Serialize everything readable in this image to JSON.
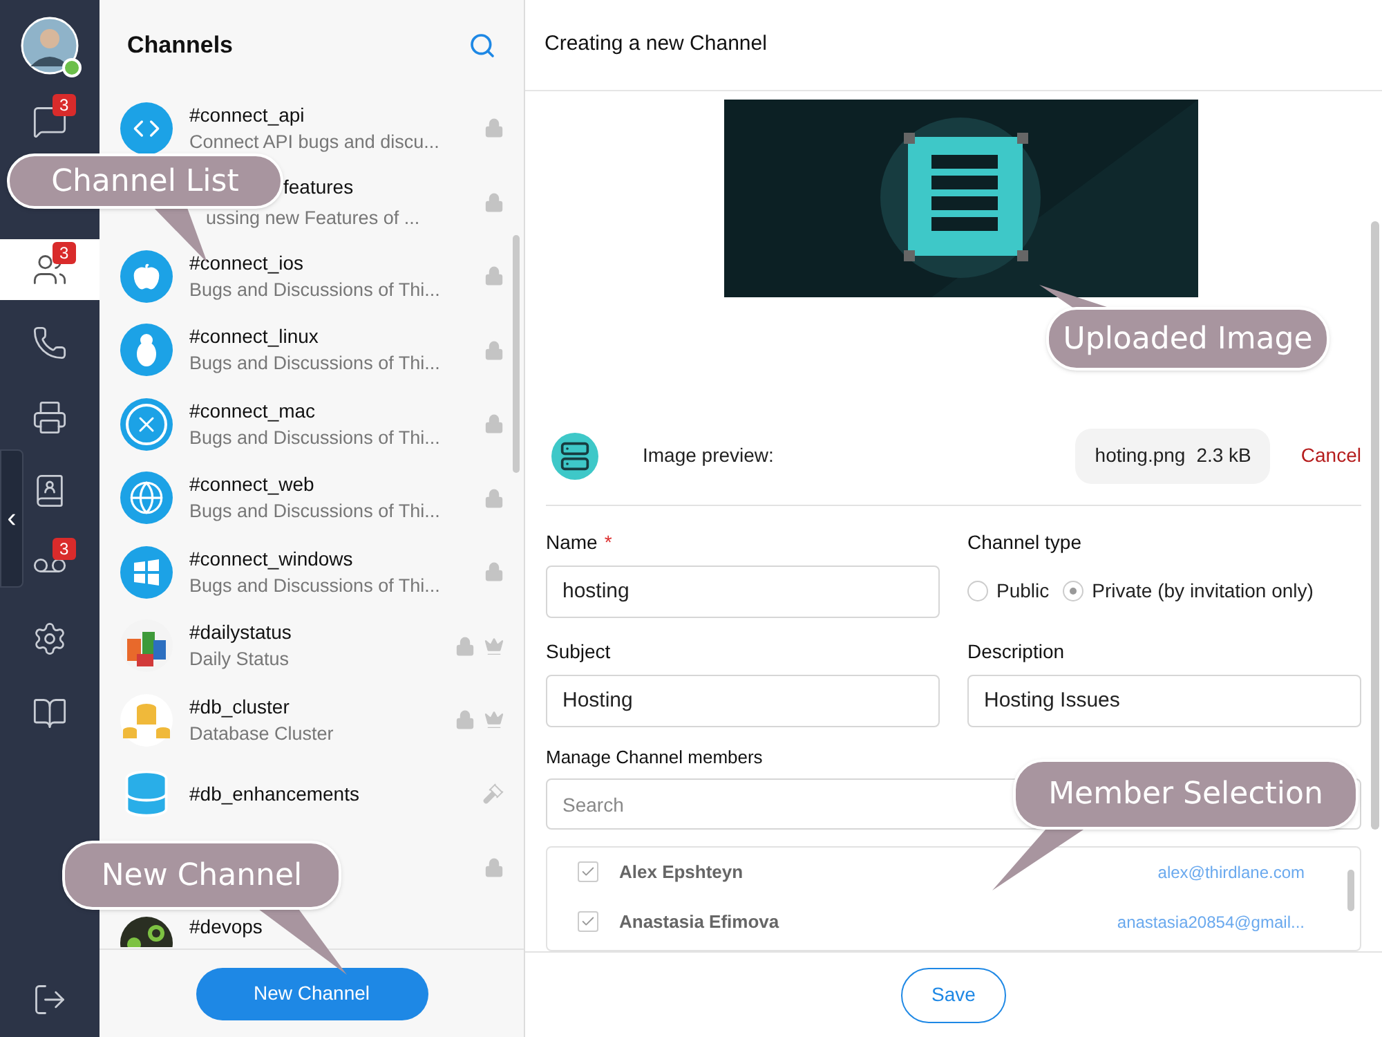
{
  "nav": {
    "user": {
      "online": true
    },
    "items": [
      {
        "kind": "chat",
        "badge": "3",
        "selected": false
      },
      {
        "kind": "contacts",
        "badge": "3",
        "selected": true
      },
      {
        "kind": "phone",
        "selected": false
      },
      {
        "kind": "printer",
        "selected": false
      },
      {
        "kind": "addressbook",
        "selected": false
      },
      {
        "kind": "voicemail",
        "badge": "3",
        "selected": false
      },
      {
        "kind": "settings",
        "selected": false
      },
      {
        "kind": "book",
        "selected": false
      }
    ],
    "collapse": "‹"
  },
  "channels": {
    "title": "Channels",
    "items": [
      {
        "name": "#connect_api",
        "description": "Connect API bugs and discu...",
        "kind": "api",
        "locked": true,
        "owner": false,
        "moderated": false
      },
      {
        "name": "features",
        "description": "ussing new Features of ...",
        "locked": true,
        "owner": false,
        "moderated": false
      },
      {
        "name": "#connect_ios",
        "description": "Bugs and Discussions of Thi...",
        "kind": "apple",
        "locked": true,
        "owner": false,
        "moderated": false
      },
      {
        "name": "#connect_linux",
        "description": "Bugs and Discussions of Thi...",
        "kind": "linux",
        "locked": true,
        "owner": false,
        "moderated": false
      },
      {
        "name": "#connect_mac",
        "description": "Bugs and Discussions of Thi...",
        "kind": "mac",
        "locked": true,
        "owner": false,
        "moderated": false
      },
      {
        "name": "#connect_web",
        "description": "Bugs and Discussions of Thi...",
        "kind": "web",
        "locked": true,
        "owner": false,
        "moderated": false
      },
      {
        "name": "#connect_windows",
        "description": "Bugs and Discussions of Thi...",
        "kind": "windows",
        "locked": true,
        "owner": false,
        "moderated": false
      },
      {
        "name": "#dailystatus",
        "description": "Daily Status",
        "kind": "picture",
        "locked": true,
        "owner": true,
        "moderated": false
      },
      {
        "name": "#db_cluster",
        "description": "Database Cluster",
        "kind": "cluster",
        "locked": true,
        "owner": true,
        "moderated": false
      },
      {
        "name": "#db_enhancements",
        "kind": "database",
        "locked": false,
        "owner": false,
        "moderated": true
      },
      {
        "locked": true,
        "owner": false,
        "moderated": false
      },
      {
        "name": "#devops",
        "kind": "picture",
        "locked": false,
        "owner": false,
        "moderated": false
      }
    ],
    "new_button": "New Channel"
  },
  "form": {
    "title": "Creating a new Channel",
    "preview_label": "Image preview:",
    "file_name": "hoting.png",
    "file_size": "2.3 kB",
    "cancel": "Cancel",
    "name": {
      "label": "Name",
      "required_mark": "*",
      "value": "hosting"
    },
    "channel_type": {
      "label": "Channel type",
      "options": [
        {
          "label": "Public",
          "selected": false
        },
        {
          "label": "Private (by invitation only)",
          "selected": true
        }
      ]
    },
    "subject": {
      "label": "Subject",
      "value": "Hosting"
    },
    "description": {
      "label": "Description",
      "value": "Hosting Issues"
    },
    "members": {
      "label": "Manage Channel members",
      "search_placeholder": "Search",
      "rows": [
        {
          "name": "Alex Epshteyn",
          "email": "alex@thirdlane.com",
          "checked": true
        },
        {
          "name": "Anastasia Efimova",
          "email": "anastasia20854@gmail...",
          "checked": true
        }
      ]
    },
    "save": "Save"
  },
  "callouts": [
    {
      "kind": "channel_list",
      "text": "Channel List"
    },
    {
      "kind": "uploaded_image",
      "text": "Uploaded Image"
    },
    {
      "kind": "member_selection",
      "text": "Member Selection"
    },
    {
      "kind": "new_channel",
      "text": "New Channel"
    }
  ]
}
